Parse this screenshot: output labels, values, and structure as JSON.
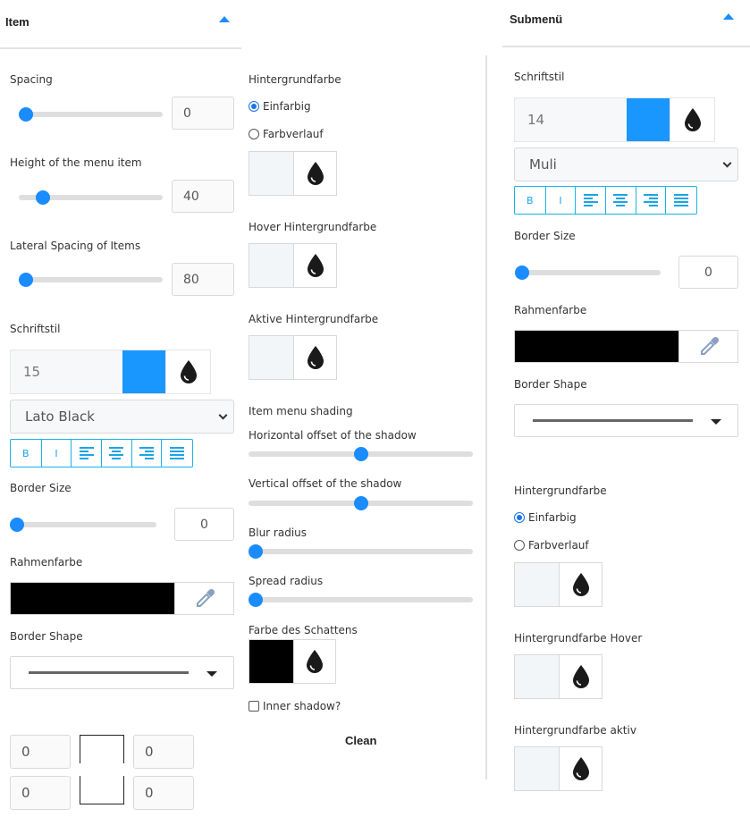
{
  "colors": {
    "accent": "#1a8cff",
    "swatch_blue": "#1a97ff",
    "black": "#000000",
    "light": "#f3f6f9"
  },
  "item": {
    "header": "Item",
    "spacing": {
      "label": "Spacing",
      "value": "0",
      "fraction": 0.0
    },
    "height": {
      "label": "Height of the menu item",
      "value": "40",
      "fraction": 0.13
    },
    "lateral": {
      "label": "Lateral Spacing of Items",
      "value": "80",
      "fraction": 0.0
    },
    "font_style": {
      "label": "Schriftstil",
      "size": "15",
      "family": "Lato Black"
    },
    "format_buttons": [
      "B",
      "I",
      "align-left-icon",
      "align-center-icon",
      "align-right-icon",
      "align-justify-icon"
    ],
    "border_size": {
      "label": "Border Size",
      "value": "0",
      "fraction": 0.0
    },
    "border_color_label": "Rahmenfarbe",
    "border_shape_label": "Border Shape",
    "corners": {
      "top_left": "0",
      "top_right": "0",
      "bottom_left": "0",
      "bottom_right": "0"
    }
  },
  "middle": {
    "bg_label": "Hintergrundfarbe",
    "radio_solid": "Einfarbig",
    "radio_gradient": "Farbverlauf",
    "hover_bg_label": "Hover Hintergrundfarbe",
    "active_bg_label": "Aktive Hintergrundfarbe",
    "shading_label": "Item menu shading",
    "h_offset": {
      "label": "Horizontal offset of the shadow",
      "fraction": 0.5
    },
    "v_offset": {
      "label": "Vertical offset of the shadow",
      "fraction": 0.5
    },
    "blur": {
      "label": "Blur radius",
      "fraction": 0.0
    },
    "spread": {
      "label": "Spread radius",
      "fraction": 0.0
    },
    "shadow_color_label": "Farbe des Schattens",
    "inner_shadow_label": "Inner shadow?",
    "clean_label": "Clean"
  },
  "submenu": {
    "header": "Submenü",
    "font_style": {
      "label": "Schriftstil",
      "size": "14",
      "family": "Muli"
    },
    "border_size": {
      "label": "Border Size",
      "value": "0",
      "fraction": 0.0
    },
    "border_color_label": "Rahmenfarbe",
    "border_shape_label": "Border Shape",
    "bg_label": "Hintergrundfarbe",
    "radio_solid": "Einfarbig",
    "radio_gradient": "Farbverlauf",
    "bg_hover_label": "Hintergrundfarbe Hover",
    "bg_active_label": "Hintergrundfarbe aktiv"
  }
}
